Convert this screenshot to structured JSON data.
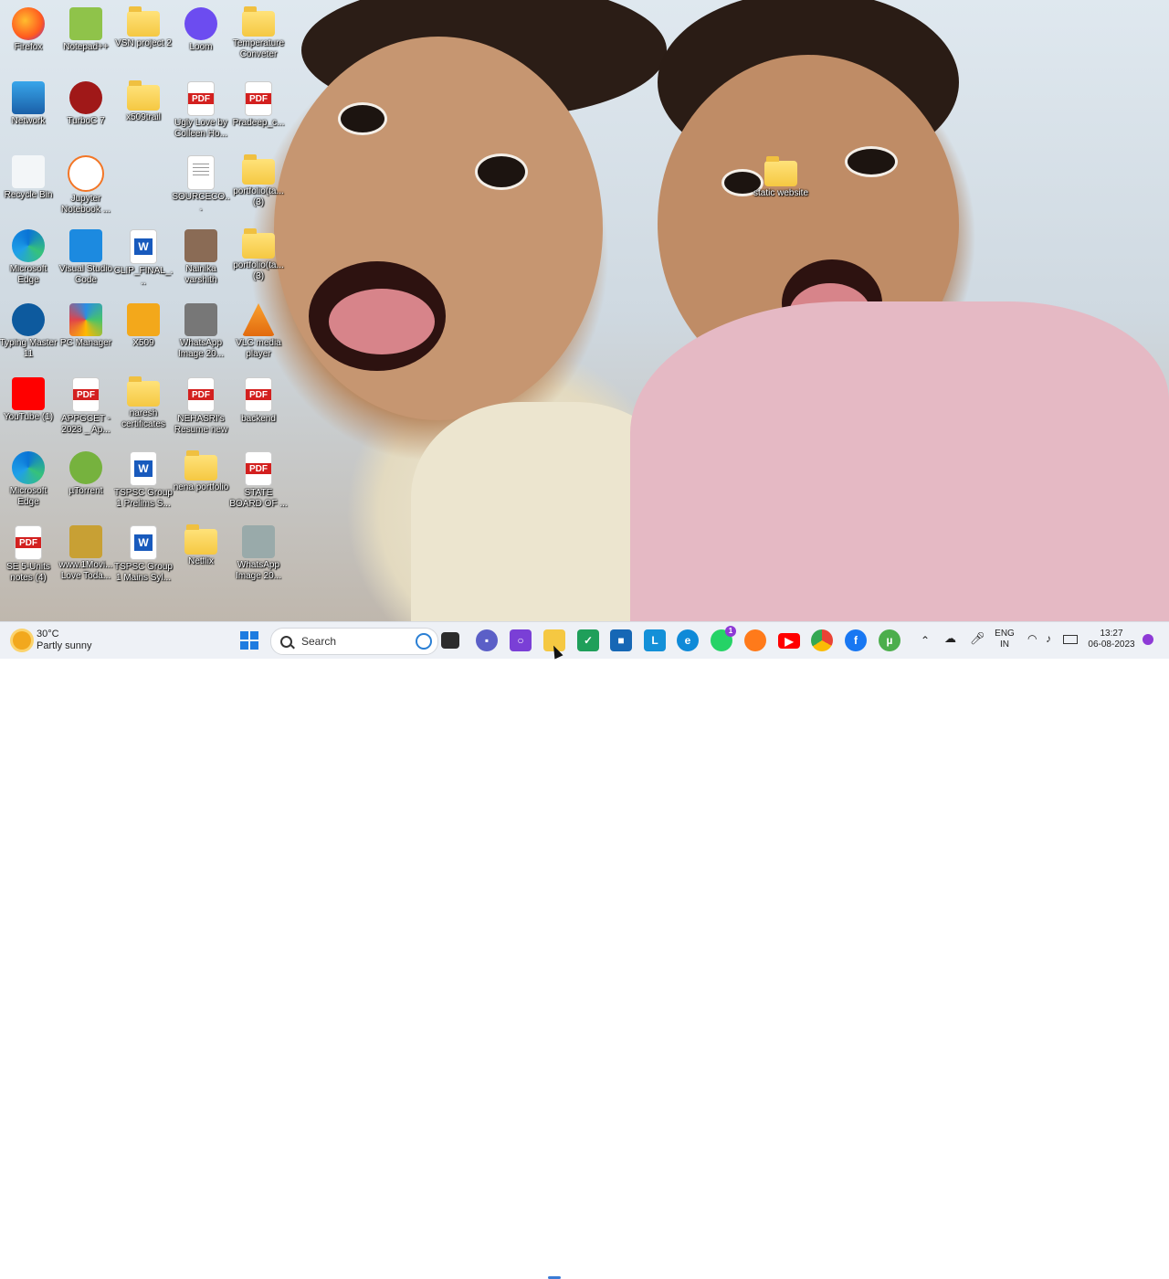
{
  "desktop": {
    "icons": [
      {
        "label": "Firefox",
        "kind": "firefox",
        "col": 0,
        "row": 0
      },
      {
        "label": "Notepad++",
        "kind": "notepad",
        "col": 1,
        "row": 0
      },
      {
        "label": "VSN project 2",
        "kind": "folder",
        "col": 2,
        "row": 0
      },
      {
        "label": "Loom",
        "kind": "loom",
        "col": 3,
        "row": 0
      },
      {
        "label": "Temperature Conveter",
        "kind": "folder",
        "col": 4,
        "row": 0
      },
      {
        "label": "Network",
        "kind": "network",
        "col": 0,
        "row": 1
      },
      {
        "label": "TurboC 7",
        "kind": "turboc",
        "col": 1,
        "row": 1
      },
      {
        "label": "x509trail",
        "kind": "folder",
        "col": 2,
        "row": 1
      },
      {
        "label": "Ugly Love by Colleen Ho...",
        "kind": "pdf",
        "col": 3,
        "row": 1
      },
      {
        "label": "Pradeep_c...",
        "kind": "pdf",
        "col": 4,
        "row": 1
      },
      {
        "label": "Recycle Bin",
        "kind": "recycle",
        "col": 0,
        "row": 2
      },
      {
        "label": "Jupyter Notebook ...",
        "kind": "jupyter",
        "col": 1,
        "row": 2
      },
      {
        "label": "SOURCECO...",
        "kind": "doc",
        "col": 3,
        "row": 2
      },
      {
        "label": "portfolio(ta... (3)",
        "kind": "folder",
        "col": 4,
        "row": 2
      },
      {
        "label": "Microsoft Edge",
        "kind": "edge",
        "col": 0,
        "row": 3
      },
      {
        "label": "Visual Studio Code",
        "kind": "vscode",
        "col": 1,
        "row": 3
      },
      {
        "label": "CLIP_FINAL_...",
        "kind": "word",
        "col": 2,
        "row": 3
      },
      {
        "label": "Nainika varshith",
        "kind": "photo",
        "col": 3,
        "row": 3
      },
      {
        "label": "portfolio(ta... (3)",
        "kind": "folder",
        "col": 4,
        "row": 3
      },
      {
        "label": "Typing Master 11",
        "kind": "typing",
        "col": 0,
        "row": 4
      },
      {
        "label": "PC Manager",
        "kind": "pcmanager",
        "col": 1,
        "row": 4
      },
      {
        "label": "X509",
        "kind": "x509",
        "col": 2,
        "row": 4
      },
      {
        "label": "WhatsApp Image 20...",
        "kind": "image",
        "col": 3,
        "row": 4
      },
      {
        "label": "VLC media player",
        "kind": "vlc",
        "col": 4,
        "row": 4
      },
      {
        "label": "YouTube (1)",
        "kind": "youtube",
        "col": 0,
        "row": 5
      },
      {
        "label": "APPGCET - 2023 _ Ap...",
        "kind": "pdf",
        "col": 1,
        "row": 5
      },
      {
        "label": "naresh certificates",
        "kind": "folder",
        "col": 2,
        "row": 5
      },
      {
        "label": "NEHASRI's Resume new",
        "kind": "pdf",
        "col": 3,
        "row": 5
      },
      {
        "label": "backend",
        "kind": "pdf",
        "col": 4,
        "row": 5
      },
      {
        "label": "Microsoft Edge",
        "kind": "edge",
        "col": 0,
        "row": 6
      },
      {
        "label": "µTorrent",
        "kind": "utorrent",
        "col": 1,
        "row": 6
      },
      {
        "label": "TSPSC Group 1 Prelims S...",
        "kind": "word",
        "col": 2,
        "row": 6
      },
      {
        "label": "nena portfolio",
        "kind": "folder",
        "col": 3,
        "row": 6
      },
      {
        "label": "STATE BOARD OF ...",
        "kind": "pdf",
        "col": 4,
        "row": 6
      },
      {
        "label": "SE 5-Units notes (4)",
        "kind": "pdf",
        "col": 0,
        "row": 7
      },
      {
        "label": "www.1Movi... Love Toda...",
        "kind": "movie",
        "col": 1,
        "row": 7
      },
      {
        "label": "TSPSC Group 1 Mains Syl...",
        "kind": "word",
        "col": 2,
        "row": 7
      },
      {
        "label": "Netflix",
        "kind": "folder",
        "col": 3,
        "row": 7
      },
      {
        "label": "WhatsApp Image 20...",
        "kind": "image2",
        "col": 4,
        "row": 7
      }
    ],
    "floating_icon": {
      "label": "static website",
      "kind": "folder"
    }
  },
  "taskbar": {
    "weather": {
      "temp": "30°C",
      "condition": "Partly sunny"
    },
    "search_placeholder": "Search",
    "apps": [
      "start",
      "search-bing",
      "task-view",
      "teams",
      "screen-recorder",
      "file-explorer",
      "excel-like",
      "store",
      "launcher",
      "edge",
      "whatsapp",
      "firefox",
      "youtube",
      "chrome",
      "facebook",
      "utorrent"
    ],
    "whatsapp_badge": "1",
    "tray": {
      "language": "ENG",
      "region": "IN",
      "time": "13:27",
      "date": "06-08-2023"
    }
  },
  "colors": {
    "folder": "#f5c842",
    "pdf": "#d3201f",
    "word": "#185abd",
    "taskbar": "#eef1f6"
  }
}
